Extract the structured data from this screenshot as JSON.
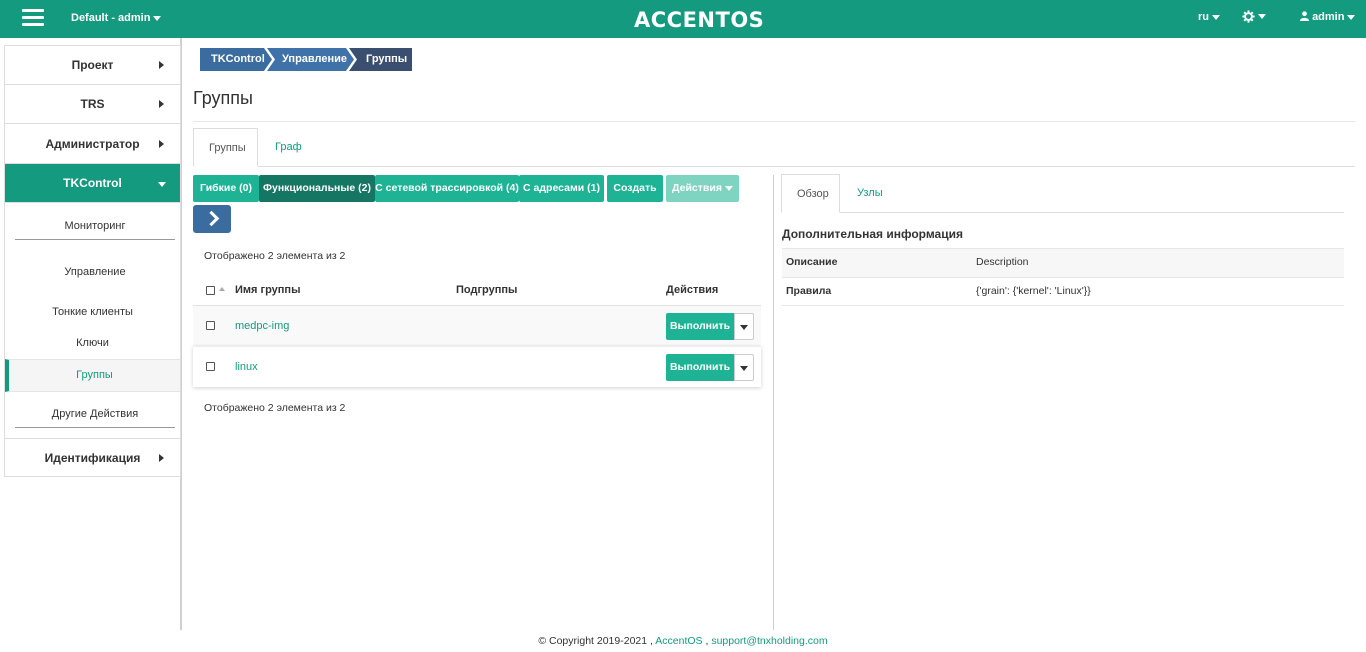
{
  "header": {
    "project": "Default - admin",
    "logo": "ACCENTOS",
    "lang": "ru",
    "user": "admin",
    "icons": {
      "menu": "hamburger-icon",
      "settings": "gear-icon",
      "user": "user-icon"
    },
    "color": "#139a7f"
  },
  "sidebar": {
    "project": "Проект",
    "trs": "TRS",
    "admin": "Администратор",
    "tkcontrol": "TKControl",
    "monitoring": "Мониторинг",
    "management": "Управление",
    "thin_clients": "Тонкие клиенты",
    "keys": "Ключи",
    "groups": "Группы",
    "other_actions": "Другие Действия",
    "identification": "Идентификация"
  },
  "breadcrumb": [
    "TKControl",
    "Управление",
    "Группы"
  ],
  "page_title": "Группы",
  "tabs": [
    "Группы",
    "Граф"
  ],
  "toolbar": {
    "flexible": "Гибкие (0)",
    "functional": "Функциональные (2)",
    "network_trace": "С сетевой трассировкой (4)",
    "addresses": "С адресами (1)",
    "create": "Создать",
    "actions": "Действия"
  },
  "table": {
    "count_top": "Отображено 2 элемента из 2",
    "count_bottom": "Отображено 2 элемента из 2",
    "columns": [
      "Имя группы",
      "Подгруппы",
      "Действия"
    ],
    "rows": [
      {
        "name": "medpc-img",
        "action": "Выполнить"
      },
      {
        "name": "linux",
        "action": "Выполнить"
      }
    ]
  },
  "details": {
    "tabs": [
      "Обзор",
      "Узлы"
    ],
    "title": "Дополнительная информация",
    "rows": [
      {
        "key": "Описание",
        "value": "Description"
      },
      {
        "key": "Правила",
        "value": "{'grain': {'kernel': 'Linux'}}"
      }
    ]
  },
  "footer": {
    "copyright": "© Copyright 2019-2021 ,",
    "brand": "AccentOS",
    "sep": ",",
    "email": "support@tnxholding.com"
  }
}
